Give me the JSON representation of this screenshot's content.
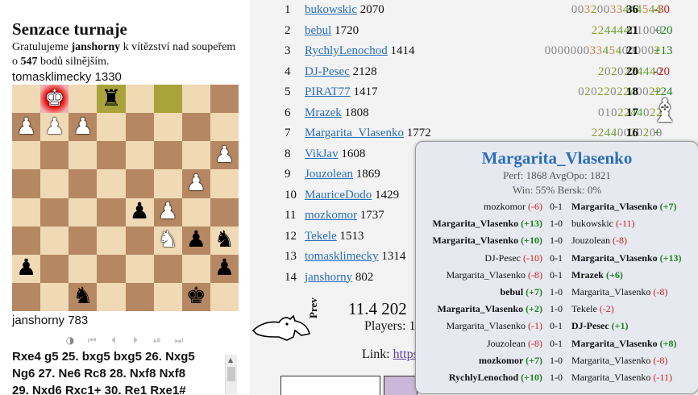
{
  "header": {
    "title": "Senzace turnaje",
    "desc_1": "Gratulujeme ",
    "desc_winner": "janshorny",
    "desc_2": " k vítězství nad soupeřem o ",
    "desc_points": "547",
    "desc_3": " bodů silnějším."
  },
  "board": {
    "top_player": "tomasklimecky 1330",
    "bottom_player": "janshorny 783",
    "squares": [
      [
        "",
        "wK",
        "",
        "bR",
        "",
        "",
        "",
        ""
      ],
      [
        "wP",
        "wP",
        "wP",
        "",
        "",
        "",
        "",
        ""
      ],
      [
        "",
        "",
        "",
        "",
        "",
        "",
        "",
        "wP"
      ],
      [
        "",
        "",
        "",
        "",
        "",
        "",
        "wP",
        ""
      ],
      [
        "",
        "",
        "",
        "",
        "bP",
        "wP",
        "",
        ""
      ],
      [
        "",
        "",
        "",
        "",
        "",
        "wN",
        "bP",
        "bN"
      ],
      [
        "bP",
        "",
        "",
        "",
        "",
        "",
        "",
        "bP"
      ],
      [
        "",
        "",
        "bN",
        "",
        "",
        "",
        "bK",
        ""
      ]
    ],
    "highlight": "f8"
  },
  "nav": {
    "icons": [
      "contrast-icon",
      "first-icon",
      "prev-icon",
      "next-icon",
      "play-icon",
      "last-icon"
    ],
    "glyphs": [
      "◑",
      "⏮",
      "⏴",
      "⏵",
      "⏯",
      "⏭"
    ]
  },
  "moves": {
    "lines": [
      "Rxe4  g5 25.  bxg5  bxg5 26.  Nxg5",
      "Ng6 27.  Ne6  Rc8 28.  Nxf8  Nxf8",
      "29.  Nxd6  Rxc1+ 30.  Re1  Rxe1#"
    ]
  },
  "standings": [
    {
      "rank": "1",
      "name": "bukowskic",
      "rating": "2070",
      "score": "00320033444544",
      "points": "36",
      "delta": "-30"
    },
    {
      "rank": "2",
      "name": "bebul",
      "rating": "1720",
      "score": "22444401000",
      "points": "21",
      "delta": "+20"
    },
    {
      "rank": "3",
      "name": "RychlyLenochod",
      "rating": "1414",
      "score": "000000033454000002",
      "points": "21",
      "delta": "+13"
    },
    {
      "rank": "4",
      "name": "DJ-Pesec",
      "rating": "2128",
      "score": "2020224440",
      "points": "20",
      "delta": "-20"
    },
    {
      "rank": "5",
      "name": "PIRAT77",
      "rating": "1417",
      "score": "0202202240022",
      "points": "18",
      "delta": "+24"
    },
    {
      "rank": "6",
      "name": "Mrazek",
      "rating": "1808",
      "score": "0102244022",
      "points": "17",
      "delta": ""
    },
    {
      "rank": "7",
      "name": "Margarita_Vlasenko",
      "rating": "1772",
      "score": "22440020200",
      "points": "16",
      "delta": "+"
    },
    {
      "rank": "8",
      "name": "VikJav",
      "rating": "1608",
      "score": "",
      "points": "",
      "delta": ""
    },
    {
      "rank": "9",
      "name": "Jouzolean",
      "rating": "1869",
      "score": "",
      "points": "",
      "delta": ""
    },
    {
      "rank": "10",
      "name": "MauriceDodo",
      "rating": "1429",
      "score": "",
      "points": "",
      "delta": ""
    },
    {
      "rank": "11",
      "name": "mozkomor",
      "rating": "1737",
      "score": "",
      "points": "",
      "delta": ""
    },
    {
      "rank": "12",
      "name": "Tekele",
      "rating": "1513",
      "score": "",
      "points": "",
      "delta": ""
    },
    {
      "rank": "13",
      "name": "tomasklimecky",
      "rating": "1314",
      "score": "",
      "points": "",
      "delta": ""
    },
    {
      "rank": "14",
      "name": "janshorny",
      "rating": "802",
      "score": "",
      "points": "",
      "delta": ""
    }
  ],
  "info": {
    "date": "11.4 202",
    "players": "Players: 1",
    "n": "N",
    "link_label": "Link: ",
    "link_text": "https"
  },
  "side": {
    "prev_label": "Prev"
  },
  "popup": {
    "name": "Margarita_Vlasenko",
    "perf": "Perf: 1868  AvgOpo: 1821",
    "win": "Win: 55%  Bersk: 0%",
    "games": [
      {
        "white": "mozkomor",
        "wd": "(-6)",
        "wbold": false,
        "res": "0-1",
        "black": "Margarita_Vlasenko",
        "bd": "(+7)",
        "bbold": true
      },
      {
        "white": "Margarita_Vlasenko",
        "wd": "(+13)",
        "wbold": true,
        "res": "1-0",
        "black": "bukowskic",
        "bd": "(-11)",
        "bbold": false
      },
      {
        "white": "Margarita_Vlasenko",
        "wd": "(+10)",
        "wbold": true,
        "res": "1-0",
        "black": "Jouzolean",
        "bd": "(-8)",
        "bbold": false
      },
      {
        "white": "DJ-Pesec",
        "wd": "(-10)",
        "wbold": false,
        "res": "0-1",
        "black": "Margarita_Vlasenko",
        "bd": "(+13)",
        "bbold": true
      },
      {
        "white": "Margarita_Vlasenko",
        "wd": "(-8)",
        "wbold": false,
        "res": "0-1",
        "black": "Mrazek",
        "bd": "(+6)",
        "bbold": true
      },
      {
        "white": "bebul",
        "wd": "(+7)",
        "wbold": true,
        "res": "1-0",
        "black": "Margarita_Vlasenko",
        "bd": "(-8)",
        "bbold": false
      },
      {
        "white": "Margarita_Vlasenko",
        "wd": "(+2)",
        "wbold": true,
        "res": "1-0",
        "black": "Tekele",
        "bd": "(-2)",
        "bbold": false
      },
      {
        "white": "Margarita_Vlasenko",
        "wd": "(-1)",
        "wbold": false,
        "res": "0-1",
        "black": "DJ-Pesec",
        "bd": "(+1)",
        "bbold": true
      },
      {
        "white": "Jouzolean",
        "wd": "(-8)",
        "wbold": false,
        "res": "0-1",
        "black": "Margarita_Vlasenko",
        "bd": "(+8)",
        "bbold": true
      },
      {
        "white": "mozkomor",
        "wd": "(+7)",
        "wbold": true,
        "res": "1-0",
        "black": "Margarita_Vlasenko",
        "bd": "(-8)",
        "bbold": false
      },
      {
        "white": "RychlyLenochod",
        "wd": "(+10)",
        "wbold": true,
        "res": "1-0",
        "black": "Margarita_Vlasenko",
        "bd": "(-11)",
        "bbold": false
      }
    ]
  }
}
